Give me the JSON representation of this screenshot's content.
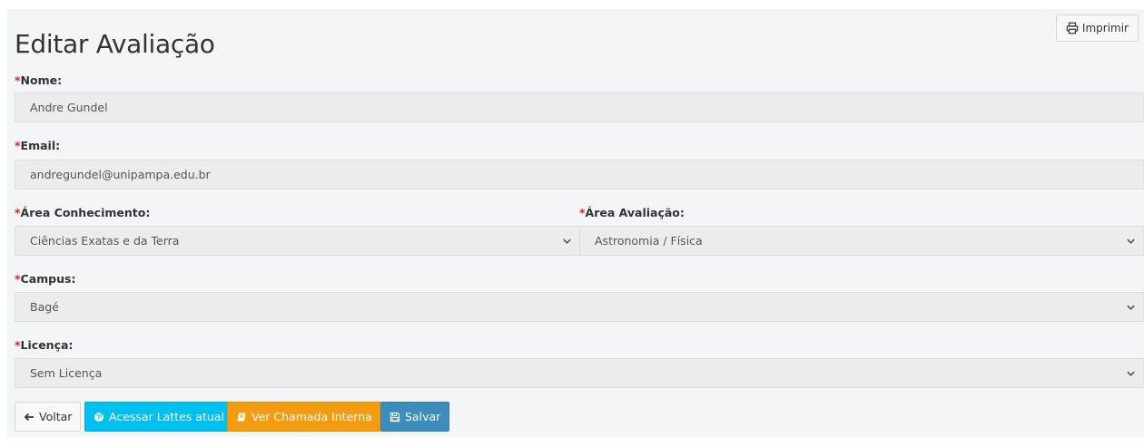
{
  "page": {
    "title": "Editar Avaliação"
  },
  "toolbar": {
    "print_label": "Imprimir"
  },
  "form": {
    "required_mark": "*",
    "nome": {
      "label": "Nome:",
      "value": "Andre Gundel"
    },
    "email": {
      "label": "Email:",
      "value": "andregundel@unipampa.edu.br"
    },
    "area_conhecimento": {
      "label": "Área Conhecimento:",
      "selected": "Ciências Exatas e da Terra"
    },
    "area_avaliacao": {
      "label": "Área Avaliação:",
      "selected": "Astronomia / Física"
    },
    "campus": {
      "label": "Campus:",
      "selected": "Bagé"
    },
    "licenca": {
      "label": "Licença:",
      "selected": "Sem Licença"
    }
  },
  "actions": {
    "voltar": "Voltar",
    "lattes": "Acessar Lattes atual",
    "chamada": "Ver Chamada Interna",
    "salvar": "Salvar"
  },
  "colors": {
    "lattes": "#00c0ef",
    "chamada": "#f39c12",
    "salvar": "#3c8dbc",
    "required": "#e02424"
  }
}
